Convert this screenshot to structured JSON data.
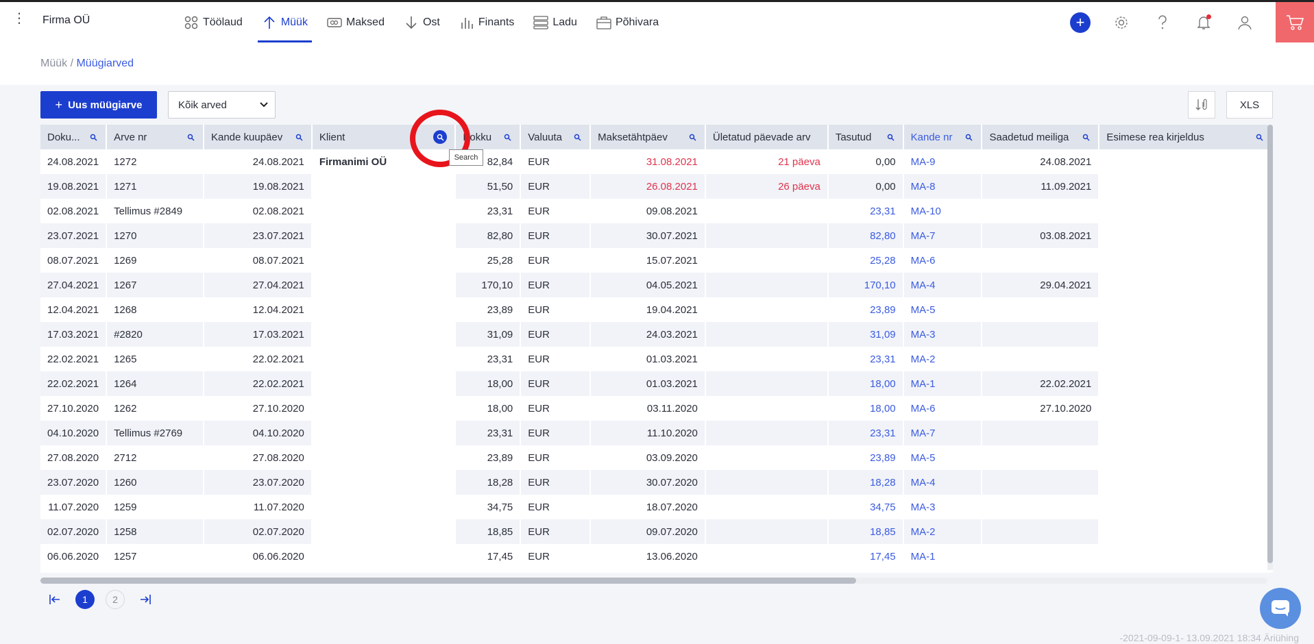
{
  "company": "Firma OÜ",
  "nav": [
    {
      "label": "Töölaud",
      "icon": "dashboard-icon"
    },
    {
      "label": "Müük",
      "icon": "arrow-up-icon",
      "active": true
    },
    {
      "label": "Maksed",
      "icon": "payments-icon"
    },
    {
      "label": "Ost",
      "icon": "arrow-down-icon"
    },
    {
      "label": "Finants",
      "icon": "bar-chart-icon"
    },
    {
      "label": "Ladu",
      "icon": "warehouse-icon"
    },
    {
      "label": "Põhivara",
      "icon": "assets-icon"
    }
  ],
  "breadcrumb": {
    "parent": "Müük",
    "separator": " / ",
    "current": "Müügiarved"
  },
  "toolbar": {
    "new_invoice": "Uus müügiarve",
    "filter_value": "Kõik arved",
    "xls": "XLS"
  },
  "tooltip": "Search",
  "columns": [
    "Doku...",
    "Arve nr",
    "Kande kuupäev",
    "Klient",
    "Kokku",
    "Valuuta",
    "Maksetähtpäev",
    "Ületatud päevade arv",
    "Tasutud",
    "Kande nr",
    "Saadetud meiliga",
    "Esimese rea kirjeldus"
  ],
  "rows": [
    [
      "24.08.2021",
      "1272",
      "24.08.2021",
      "Firmanimi OÜ",
      "82,84",
      "EUR",
      "31.08.2021",
      "21 päeva",
      "0,00",
      "MA-9",
      "24.08.2021",
      ""
    ],
    [
      "19.08.2021",
      "1271",
      "19.08.2021",
      "",
      "51,50",
      "EUR",
      "26.08.2021",
      "26 päeva",
      "0,00",
      "MA-8",
      "11.09.2021",
      ""
    ],
    [
      "02.08.2021",
      "Tellimus #2849",
      "02.08.2021",
      "",
      "23,31",
      "EUR",
      "09.08.2021",
      "",
      "23,31",
      "MA-10",
      "",
      ""
    ],
    [
      "23.07.2021",
      "1270",
      "23.07.2021",
      "",
      "82,80",
      "EUR",
      "30.07.2021",
      "",
      "82,80",
      "MA-7",
      "03.08.2021",
      ""
    ],
    [
      "08.07.2021",
      "1269",
      "08.07.2021",
      "",
      "25,28",
      "EUR",
      "15.07.2021",
      "",
      "25,28",
      "MA-6",
      "",
      ""
    ],
    [
      "27.04.2021",
      "1267",
      "27.04.2021",
      "",
      "170,10",
      "EUR",
      "04.05.2021",
      "",
      "170,10",
      "MA-4",
      "29.04.2021",
      ""
    ],
    [
      "12.04.2021",
      "1268",
      "12.04.2021",
      "",
      "23,89",
      "EUR",
      "19.04.2021",
      "",
      "23,89",
      "MA-5",
      "",
      ""
    ],
    [
      "17.03.2021",
      "#2820",
      "17.03.2021",
      "",
      "31,09",
      "EUR",
      "24.03.2021",
      "",
      "31,09",
      "MA-3",
      "",
      ""
    ],
    [
      "22.02.2021",
      "1265",
      "22.02.2021",
      "",
      "23,31",
      "EUR",
      "01.03.2021",
      "",
      "23,31",
      "MA-2",
      "",
      ""
    ],
    [
      "22.02.2021",
      "1264",
      "22.02.2021",
      "",
      "18,00",
      "EUR",
      "01.03.2021",
      "",
      "18,00",
      "MA-1",
      "22.02.2021",
      ""
    ],
    [
      "27.10.2020",
      "1262",
      "27.10.2020",
      "",
      "18,00",
      "EUR",
      "03.11.2020",
      "",
      "18,00",
      "MA-6",
      "27.10.2020",
      ""
    ],
    [
      "04.10.2020",
      "Tellimus #2769",
      "04.10.2020",
      "",
      "23,31",
      "EUR",
      "11.10.2020",
      "",
      "23,31",
      "MA-7",
      "",
      ""
    ],
    [
      "27.08.2020",
      "2712",
      "27.08.2020",
      "",
      "23,89",
      "EUR",
      "03.09.2020",
      "",
      "23,89",
      "MA-5",
      "",
      ""
    ],
    [
      "23.07.2020",
      "1260",
      "23.07.2020",
      "",
      "18,28",
      "EUR",
      "30.07.2020",
      "",
      "18,28",
      "MA-4",
      "",
      ""
    ],
    [
      "11.07.2020",
      "1259",
      "11.07.2020",
      "",
      "34,75",
      "EUR",
      "18.07.2020",
      "",
      "34,75",
      "MA-3",
      "",
      ""
    ],
    [
      "02.07.2020",
      "1258",
      "02.07.2020",
      "",
      "18,85",
      "EUR",
      "09.07.2020",
      "",
      "18,85",
      "MA-2",
      "",
      ""
    ],
    [
      "06.06.2020",
      "1257",
      "06.06.2020",
      "",
      "17,45",
      "EUR",
      "13.06.2020",
      "",
      "17,45",
      "MA-1",
      "",
      ""
    ]
  ],
  "pager": {
    "pages": [
      "1",
      "2"
    ],
    "current": "1"
  },
  "footer": "-2021-09-09-1- 13.09.2021 18:34 Äriühing",
  "colors": {
    "accent": "#1c3ecf",
    "link": "#3a5be0",
    "overdue": "#e0334d",
    "cart": "#f0686b",
    "highlight": "#e8141c"
  }
}
